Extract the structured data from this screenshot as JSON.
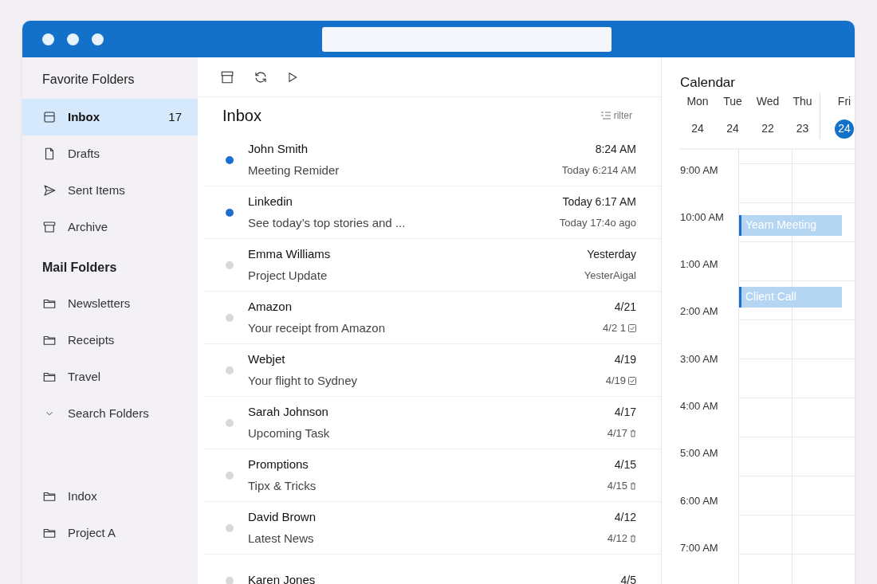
{
  "sidebar": {
    "favorites_title": "Favorite Folders",
    "favorites": [
      {
        "label": "Inbox",
        "kind": "inbox",
        "count": "17",
        "selected": true
      },
      {
        "label": "Drafts",
        "kind": "file",
        "selected": false
      },
      {
        "label": "Sent Items",
        "kind": "send",
        "selected": false
      },
      {
        "label": "Archive",
        "kind": "archive",
        "selected": false
      }
    ],
    "mail_title": "Mail Folders",
    "mail": [
      {
        "label": "Newsletters",
        "kind": "folder",
        "selected": false
      },
      {
        "label": "Receipts",
        "kind": "folder",
        "selected": false
      },
      {
        "label": "Travel",
        "kind": "folder",
        "selected": false
      },
      {
        "label": "Search Folders",
        "kind": "chevron",
        "selected": false
      }
    ],
    "bottom": [
      {
        "label": "Indox",
        "kind": "folder",
        "selected": false
      },
      {
        "label": "Project A",
        "kind": "folder",
        "selected": false
      }
    ]
  },
  "list": {
    "title": "Inbox",
    "filter": "rilter",
    "messages": [
      {
        "sender": "John Smith",
        "subject": "Meeting Remider",
        "time": "8:24 AM",
        "time2": "Today 6:214 AM",
        "unread": true
      },
      {
        "sender": "Linkedin",
        "subject": "See today’s top stories and ...",
        "time": "Today 6:17 AM",
        "time2": "Today 17:4o ago",
        "unread": true
      },
      {
        "sender": "Emma Williams",
        "subject": "Project Update",
        "time": "Yesterday",
        "time2": "YesterAigal",
        "unread": false
      },
      {
        "sender": "Amazon",
        "subject": "Your receipt from Amazon",
        "time": "4/21",
        "time2": "4/2 1",
        "kind": "check",
        "unread": false
      },
      {
        "sender": "Webjet",
        "subject": "Your flight to Sydney",
        "time": "4/19",
        "time2": "4/19",
        "kind": "check",
        "unread": false
      },
      {
        "sender": "Sarah Johnson",
        "subject": "Upcoming Task",
        "time": "4/17",
        "time2": "4/17",
        "kind": "bin",
        "unread": false
      },
      {
        "sender": "Promptions",
        "subject": "Tipx & Tricks",
        "time": "4/15",
        "time2": "4/15",
        "kind": "bin",
        "unread": false
      },
      {
        "sender": "David Brown",
        "subject": "Latest News",
        "time": "4/12",
        "time2": "4/12",
        "kind": "bin",
        "unread": false
      },
      {
        "sender": "Karen Jones",
        "time": "4/5",
        "unread": false
      }
    ]
  },
  "calendar": {
    "title": "Calendar",
    "days": [
      {
        "name": "Mon",
        "date": "24",
        "selected": false
      },
      {
        "name": "Tue",
        "date": "24",
        "selected": false
      },
      {
        "name": "Wed",
        "date": "22",
        "selected": false
      },
      {
        "name": "Thu",
        "date": "23",
        "selected": false
      },
      {
        "name": "Fri",
        "date": "24",
        "selected": true
      }
    ],
    "times": [
      "9:00 AM",
      "10:00 AM",
      "1:00 AM",
      "2:00 AM",
      "3:00 AM",
      "4:00 AM",
      "5:00 AM",
      "6:00 AM",
      "7:00 AM"
    ],
    "events": [
      {
        "title": "Yeam Meeting"
      },
      {
        "title": "Client Call"
      }
    ]
  }
}
